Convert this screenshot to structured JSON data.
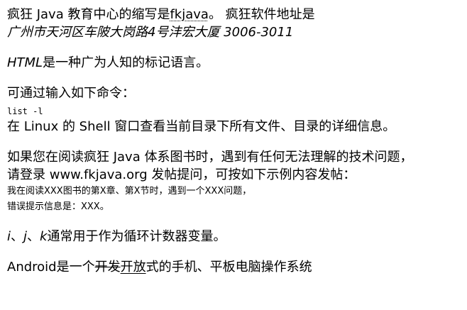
{
  "p1": {
    "before": "疯狂 Java 教育中心的缩写是",
    "abbr": "fkjava",
    "after": "。 疯狂软件地址是",
    "address": "广州市天河区车陂大岗路4号沣宏大厦 3006-3011"
  },
  "p2": {
    "term": "HTML",
    "rest": "是一种广为人知的标记语言。"
  },
  "p3": {
    "intro": "可通过输入如下命令：",
    "command": "list -l",
    "desc": "在 Linux 的 Shell 窗口查看当前目录下所有文件、目录的详细信息。"
  },
  "p4": {
    "line1": "如果您在阅读疯狂 Java 体系图书时，遇到有任何无法理解的技术问题，",
    "line2": "请登录 www.fkjava.org 发帖提问，可按如下示例内容发帖：",
    "sample1": "我在阅读XXX图书的第X章、第X节时，遇到一个XXX问题，",
    "sample2": "错误提示信息是：XXX。"
  },
  "p5": {
    "v1": "i",
    "sep1": "、",
    "v2": "j",
    "sep2": "、",
    "v3": "k",
    "rest": "通常用于作为循环计数器变量。"
  },
  "p6": {
    "before": "Android是一个",
    "deleted": "开发",
    "inserted": "开放",
    "after": "式的手机、平板电脑操作系统"
  }
}
